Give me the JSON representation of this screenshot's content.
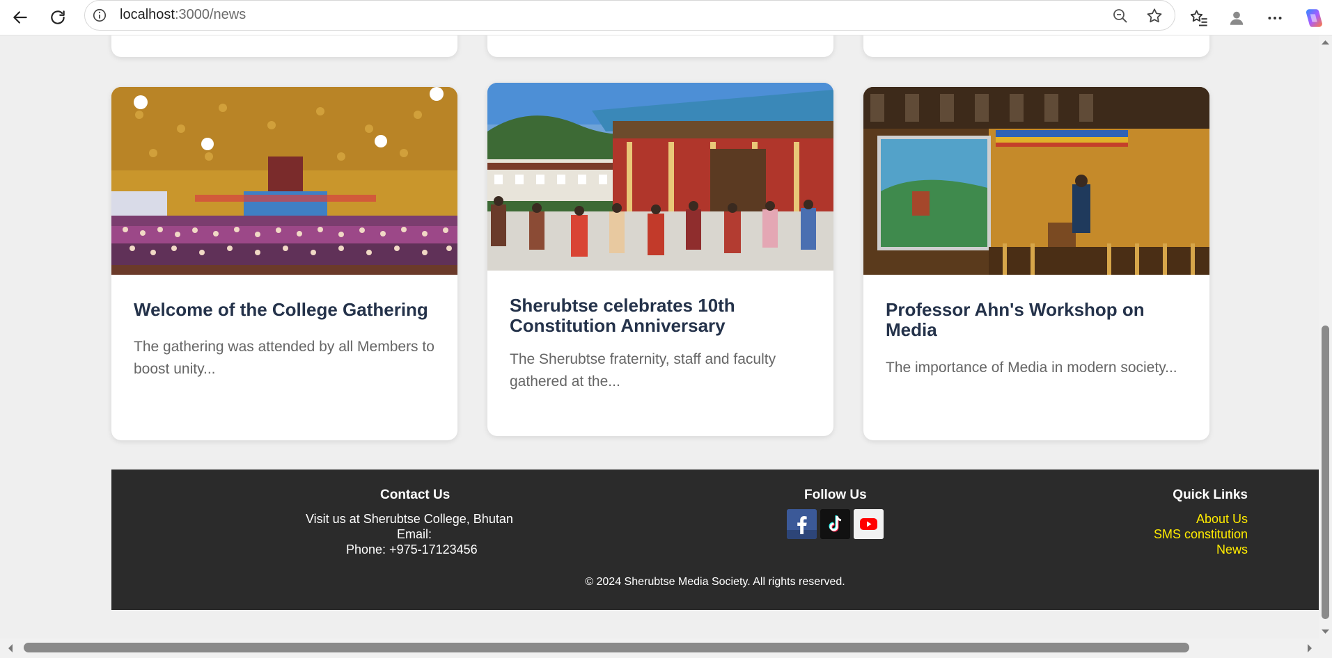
{
  "browser": {
    "url_host": "localhost",
    "url_path": ":3000/news",
    "icons": [
      "back-icon",
      "reload-icon",
      "site-info-icon",
      "zoom-out-icon",
      "favorite-star-icon",
      "favorites-icon",
      "profile-icon",
      "more-icon",
      "copilot-icon"
    ]
  },
  "news": [
    {
      "title": "Welcome of the College Gathering",
      "excerpt": "The gathering was attended by all Members to boost unity..."
    },
    {
      "title": "Sherubtse celebrates 10th Constitution Anniversary",
      "excerpt": "The Sherubtse fraternity, staff and faculty gathered at the..."
    },
    {
      "title": "Professor Ahn's Workshop on Media",
      "excerpt": "The importance of Media in modern society..."
    }
  ],
  "footer": {
    "contact": {
      "heading": "Contact Us",
      "address": "Visit us at Sherubtse College, Bhutan",
      "email": "Email:",
      "phone": "Phone: +975-17123456"
    },
    "follow": {
      "heading": "Follow Us",
      "networks": [
        "facebook-icon",
        "tiktok-icon",
        "youtube-icon"
      ]
    },
    "quick_links": {
      "heading": "Quick Links",
      "links": [
        "About Us",
        "SMS constitution",
        "News"
      ]
    },
    "copyright": "© 2024 Sherubtse Media Society. All rights reserved."
  },
  "colors": {
    "link_yellow": "#ffeb00",
    "footer_bg": "#2b2b2b",
    "title_navy": "#24324a",
    "page_bg": "#efefef"
  }
}
